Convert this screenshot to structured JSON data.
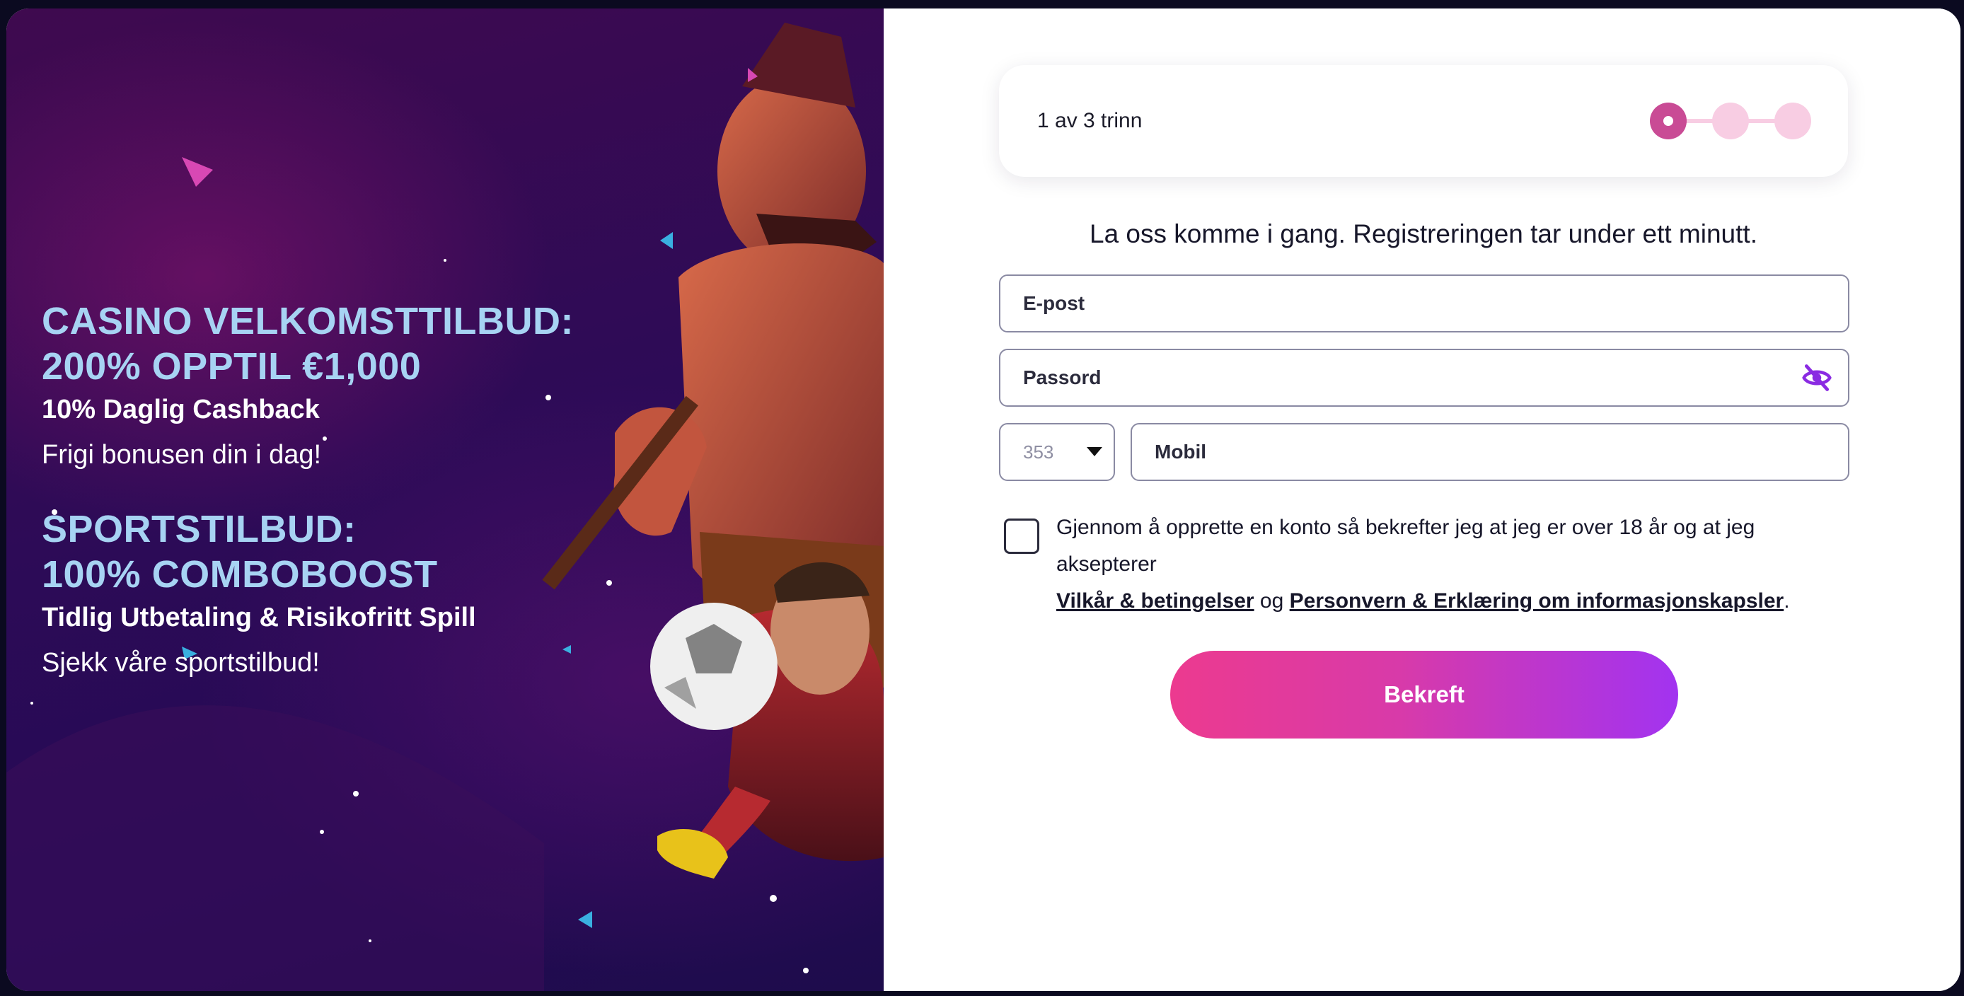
{
  "promo": {
    "casino_title_line1": "CASINO VELKOMSTTILBUD:",
    "casino_title_line2": "200% OPPTIL €1,000",
    "casino_sub": "10% Daglig Cashback",
    "casino_cta": "Frigi bonusen din i dag!",
    "sport_title_line1": "SPORTSTILBUD:",
    "sport_title_line2": "100% COMBOBOOST",
    "sport_sub": "Tidlig Utbetaling & Risikofritt Spill",
    "sport_cta": "Sjekk våre sportstilbud!"
  },
  "stepper": {
    "label": "1 av 3 trinn",
    "total_steps": 3,
    "current_step": 1
  },
  "form": {
    "intro": "La oss komme i gang. Registreringen tar under ett minutt.",
    "email_placeholder": "E-post",
    "password_placeholder": "Passord",
    "password_toggle_icon": "eye-off-icon",
    "country_code": "353",
    "mobile_placeholder": "Mobil",
    "terms_prefix": "Gjennom å opprette en konto så bekrefter jeg at jeg er over 18 år og at jeg aksepterer",
    "terms_link": "Vilkår & betingelser",
    "terms_joiner": "og",
    "privacy_link": "Personvern & Erklæring om informasjonskapsler",
    "terms_suffix": ".",
    "submit_label": "Bekreft"
  },
  "colors": {
    "accent_pink": "#ec3a8f",
    "accent_purple": "#a233f0",
    "step_active": "#c94b95",
    "step_inactive": "#f8cde3",
    "promo_title": "#a7d3f3"
  }
}
